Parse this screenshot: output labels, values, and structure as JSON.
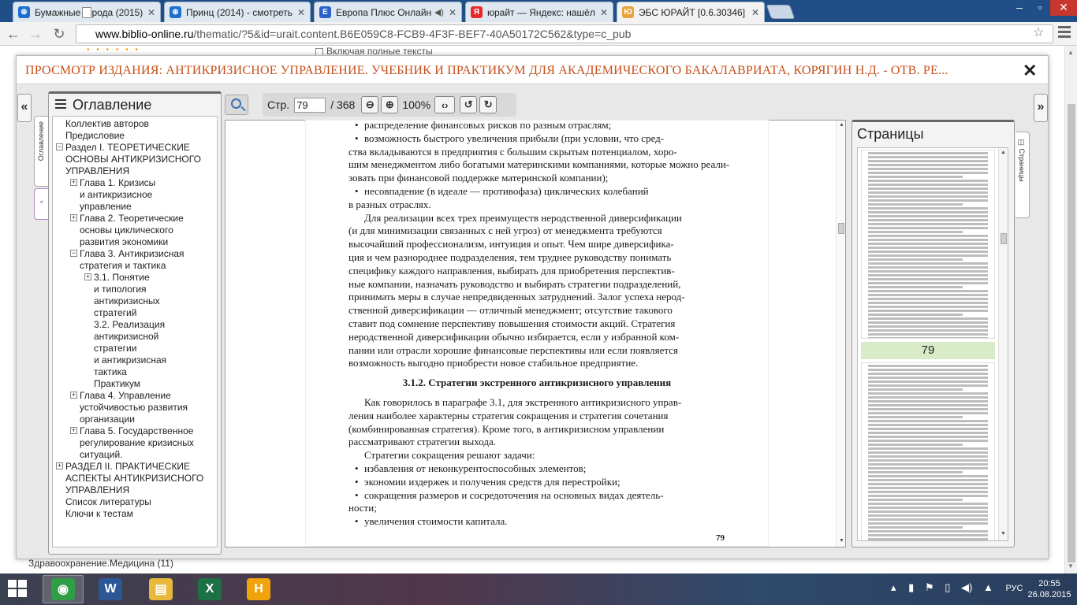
{
  "browser": {
    "tabs": [
      {
        "title": "Бумажные города (2015)",
        "favicon_color": "#1e6fd0",
        "favicon_glyph": "⊛",
        "sound": false
      },
      {
        "title": "Принц (2014) - смотреть",
        "favicon_color": "#1e6fd0",
        "favicon_glyph": "⊛",
        "sound": false
      },
      {
        "title": "Европа Плюс Онлайн",
        "favicon_color": "#2a62c9",
        "favicon_glyph": "E",
        "sound": true
      },
      {
        "title": "юрайт — Яндекс: нашёлс",
        "favicon_color": "#e52b2b",
        "favicon_glyph": "Я",
        "sound": false
      },
      {
        "title": "ЭБС ЮРАЙТ [0.6.30346]",
        "favicon_color": "#e8a33a",
        "favicon_glyph": "Ю",
        "sound": false
      }
    ],
    "url_host": "www.biblio-online.ru",
    "url_path": "/thematic/?5&id=urait.content.B6E059C8-FCB9-4F3F-BEF7-40A50172C562&type=c_pub"
  },
  "behind": {
    "top_text": "Включая полные тексты",
    "bottom_text": "Здравоохранение.Медицина (11)"
  },
  "viewer": {
    "title": "ПРОСМОТР ИЗДАНИЯ: АНТИКРИЗИСНОЕ УПРАВЛЕНИЕ. УЧЕБНИК И ПРАКТИКУМ ДЛЯ АКАДЕМИЧЕСКОГО БАКАЛАВРИАТА, КОРЯГИН Н.Д. - ОТВ. РЕ...",
    "close_glyph": "✕",
    "left_arrow": "«",
    "right_arrow": "»",
    "toc_tab_label": "Оглавление",
    "pages_tab_label": "Страницы",
    "page_label": "Стр.",
    "page_value": "79",
    "page_total": "/ 368",
    "zoom": "100%"
  },
  "toc": {
    "title": "Оглавление",
    "items": [
      {
        "label": "Коллектив авторов",
        "level": 0,
        "toggle": ""
      },
      {
        "label": "Предисловие",
        "level": 0,
        "toggle": ""
      },
      {
        "label": "Раздел I. ТЕОРЕТИЧЕСКИЕ",
        "level": 0,
        "toggle": "−"
      },
      {
        "label": "ОСНОВЫ АНТИКРИЗИСНОГО",
        "level": 0,
        "toggle": ""
      },
      {
        "label": "УПРАВЛЕНИЯ",
        "level": 0,
        "toggle": ""
      },
      {
        "label": "Глава 1. Кризисы",
        "level": 1,
        "toggle": "+"
      },
      {
        "label": "и антикризисное",
        "level": 1,
        "toggle": ""
      },
      {
        "label": "управление",
        "level": 1,
        "toggle": ""
      },
      {
        "label": "Глава 2. Теоретические",
        "level": 1,
        "toggle": "+"
      },
      {
        "label": "основы циклического",
        "level": 1,
        "toggle": ""
      },
      {
        "label": "развития экономики",
        "level": 1,
        "toggle": ""
      },
      {
        "label": "Глава 3. Антикризисная",
        "level": 1,
        "toggle": "−"
      },
      {
        "label": "стратегия и тактика",
        "level": 1,
        "toggle": ""
      },
      {
        "label": "3.1. Понятие",
        "level": 2,
        "toggle": "+"
      },
      {
        "label": "и типология",
        "level": 2,
        "toggle": ""
      },
      {
        "label": "антикризисных",
        "level": 2,
        "toggle": ""
      },
      {
        "label": "стратегий",
        "level": 2,
        "toggle": ""
      },
      {
        "label": "3.2. Реализация",
        "level": 2,
        "toggle": ""
      },
      {
        "label": "антикризисной",
        "level": 2,
        "toggle": ""
      },
      {
        "label": "стратегии",
        "level": 2,
        "toggle": ""
      },
      {
        "label": "и антикризисная",
        "level": 2,
        "toggle": ""
      },
      {
        "label": "тактика",
        "level": 2,
        "toggle": ""
      },
      {
        "label": "Практикум",
        "level": 2,
        "toggle": ""
      },
      {
        "label": "Глава 4. Управление",
        "level": 1,
        "toggle": "+"
      },
      {
        "label": "устойчивостью развития",
        "level": 1,
        "toggle": ""
      },
      {
        "label": "организации",
        "level": 1,
        "toggle": ""
      },
      {
        "label": "Глава 5. Государственное",
        "level": 1,
        "toggle": "+"
      },
      {
        "label": "регулирование кризисных",
        "level": 1,
        "toggle": ""
      },
      {
        "label": "ситуаций.",
        "level": 1,
        "toggle": ""
      },
      {
        "label": "РАЗДЕЛ II. ПРАКТИЧЕСКИЕ",
        "level": 0,
        "toggle": "+"
      },
      {
        "label": "АСПЕКТЫ АНТИКРИЗИСНОГО",
        "level": 0,
        "toggle": ""
      },
      {
        "label": "УПРАВЛЕНИЯ",
        "level": 0,
        "toggle": ""
      },
      {
        "label": "Список литературы",
        "level": 0,
        "toggle": ""
      },
      {
        "label": "Ключи к тестам",
        "level": 0,
        "toggle": ""
      }
    ]
  },
  "document": {
    "lines": [
      {
        "t": "распределение финансовых рисков по разным отраслям;",
        "k": "bul"
      },
      {
        "t": "возможность быстрого увеличения прибыли (при условии, что сред-",
        "k": "bul"
      },
      {
        "t": "ства вкладываются в предприятия с большим скрытым потенциалом, хоро-",
        "k": "txt"
      },
      {
        "t": "шим менеджментом либо богатыми материнскими компаниями, которые можно реали-",
        "k": "txt"
      },
      {
        "t": "зовать при финансовой поддержке материнской компании);",
        "k": "txt"
      },
      {
        "t": "несовпадение (в идеале — противофаза) циклических колебаний",
        "k": "bul"
      },
      {
        "t": "в разных отраслях.",
        "k": "txt"
      },
      {
        "t": "Для реализации всех трех преимуществ неродственной диверсификации",
        "k": "ind"
      },
      {
        "t": "(и для минимизации связанных с ней угроз) от менеджмента требуются",
        "k": "txt"
      },
      {
        "t": "высочайший профессионализм, интуиция и опыт. Чем шире диверсифика-",
        "k": "txt"
      },
      {
        "t": "ция и чем разнороднее подразделения, тем труднее руководству понимать",
        "k": "txt"
      },
      {
        "t": "специфику каждого направления, выбирать для приобретения перспектив-",
        "k": "txt"
      },
      {
        "t": "ные компании, назначать руководство и выбирать стратегии подразделений,",
        "k": "txt"
      },
      {
        "t": "принимать меры в случае непредвиденных затруднений. Залог успеха нерод-",
        "k": "txt"
      },
      {
        "t": "ственной диверсификации — отличный менеджмент; отсутствие такового",
        "k": "txt"
      },
      {
        "t": "ставит под сомнение перспективу повышения стоимости акций. Стратегия",
        "k": "txt"
      },
      {
        "t": "неродственной диверсификации обычно избирается, если у избранной ком-",
        "k": "txt"
      },
      {
        "t": "пании или отрасли хорошие финансовые перспективы или если появляется",
        "k": "txt"
      },
      {
        "t": "возможность выгодно приобрести новое стабильное предприятие.",
        "k": "txt"
      },
      {
        "t": "",
        "k": "gap"
      },
      {
        "t": "3.1.2. Стратегии экстренного антикризисного управления",
        "k": "h"
      },
      {
        "t": "",
        "k": "gap"
      },
      {
        "t": "Как говорилось в параграфе 3.1, для экстренного антикризисного управ-",
        "k": "ind"
      },
      {
        "t": "ления наиболее характерны стратегия сокращения и стратегия сочетания",
        "k": "txt"
      },
      {
        "t": "(комбинированная стратегия). Кроме того, в антикризисном управлении",
        "k": "txt"
      },
      {
        "t": "рассматривают стратегии выхода.",
        "k": "txt"
      },
      {
        "t": "Стратегии сокращения решают задачи:",
        "k": "ind"
      },
      {
        "t": "избавления от неконкурентоспособных элементов;",
        "k": "bul"
      },
      {
        "t": "экономии издержек и получения средств для перестройки;",
        "k": "bul"
      },
      {
        "t": "сокращения размеров и сосредоточения на основных видах деятель-",
        "k": "bul"
      },
      {
        "t": "ности;",
        "k": "txt"
      },
      {
        "t": "увеличения стоимости капитала.",
        "k": "bul"
      }
    ],
    "page_number": "79"
  },
  "pages": {
    "title": "Страницы",
    "current_page": "79"
  },
  "taskbar": {
    "lang": "РУС",
    "time": "20:55",
    "date": "26.08.2015",
    "apps": [
      {
        "name": "chrome",
        "color": "#2f9e44",
        "glyph": "◉"
      },
      {
        "name": "word",
        "color": "#2b5797",
        "glyph": "W"
      },
      {
        "name": "explorer",
        "color": "#e8b93b",
        "glyph": "▤"
      },
      {
        "name": "excel",
        "color": "#1e7145",
        "glyph": "X"
      },
      {
        "name": "app-h",
        "color": "#f0a30a",
        "glyph": "H"
      }
    ]
  }
}
